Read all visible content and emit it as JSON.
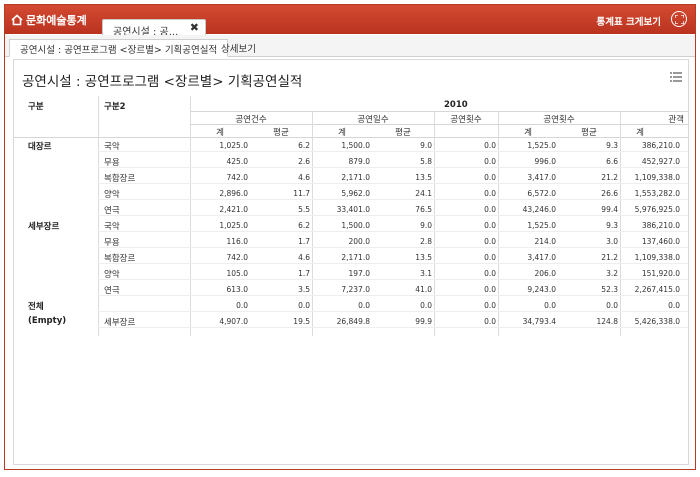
{
  "header": {
    "home_label": "문화예술통계",
    "main_tab_label": "공연시설 : 공...",
    "main_tab_close": "✖",
    "view_big_label": "통계표 크게보기"
  },
  "subtabs": [
    "공연시설 : 공연프로그램 <장르별> 기획공연실적",
    "상세보기"
  ],
  "report": {
    "title": "공연시설 : 공연프로그램 <장르별> 기획공연실적",
    "col1_header": "구분",
    "col2_header": "구분2",
    "year": "2010",
    "groups": [
      "공연건수",
      "공연일수",
      "공연횟수",
      "공연횟수",
      "관객"
    ],
    "subcols": [
      "계",
      "평균",
      "계",
      "평균",
      "",
      "계",
      "평균",
      "계"
    ],
    "rows": [
      {
        "g1": "대장르",
        "g2": "국악",
        "vals": [
          "1,025.0",
          "6.2",
          "1,500.0",
          "9.0",
          "0.0",
          "1,525.0",
          "9.3",
          "386,210.0"
        ]
      },
      {
        "g1": "",
        "g2": "무용",
        "vals": [
          "425.0",
          "2.6",
          "879.0",
          "5.8",
          "0.0",
          "996.0",
          "6.6",
          "452,927.0"
        ]
      },
      {
        "g1": "",
        "g2": "복합장르",
        "vals": [
          "742.0",
          "4.6",
          "2,171.0",
          "13.5",
          "0.0",
          "3,417.0",
          "21.2",
          "1,109,338.0"
        ]
      },
      {
        "g1": "",
        "g2": "양악",
        "vals": [
          "2,896.0",
          "11.7",
          "5,962.0",
          "24.1",
          "0.0",
          "6,572.0",
          "26.6",
          "1,553,282.0"
        ]
      },
      {
        "g1": "",
        "g2": "연극",
        "vals": [
          "2,421.0",
          "5.5",
          "33,401.0",
          "76.5",
          "0.0",
          "43,246.0",
          "99.4",
          "5,976,925.0"
        ]
      },
      {
        "g1": "세부장르",
        "g2": "국악",
        "vals": [
          "1,025.0",
          "6.2",
          "1,500.0",
          "9.0",
          "0.0",
          "1,525.0",
          "9.3",
          "386,210.0"
        ]
      },
      {
        "g1": "",
        "g2": "무용",
        "vals": [
          "116.0",
          "1.7",
          "200.0",
          "2.8",
          "0.0",
          "214.0",
          "3.0",
          "137,460.0"
        ]
      },
      {
        "g1": "",
        "g2": "복합장르",
        "vals": [
          "742.0",
          "4.6",
          "2,171.0",
          "13.5",
          "0.0",
          "3,417.0",
          "21.2",
          "1,109,338.0"
        ]
      },
      {
        "g1": "",
        "g2": "양악",
        "vals": [
          "105.0",
          "1.7",
          "197.0",
          "3.1",
          "0.0",
          "206.0",
          "3.2",
          "151,920.0"
        ]
      },
      {
        "g1": "",
        "g2": "연극",
        "vals": [
          "613.0",
          "3.5",
          "7,237.0",
          "41.0",
          "0.0",
          "9,243.0",
          "52.3",
          "2,267,415.0"
        ]
      },
      {
        "g1": "전체",
        "g2": "",
        "vals": [
          "0.0",
          "0.0",
          "0.0",
          "0.0",
          "0.0",
          "0.0",
          "0.0",
          "0.0"
        ]
      },
      {
        "g1": "(Empty)",
        "g2": "세부장르",
        "vals": [
          "4,907.0",
          "19.5",
          "26,849.8",
          "99.9",
          "0.0",
          "34,793.4",
          "124.8",
          "5,426,338.0"
        ]
      }
    ]
  },
  "colors": {
    "brand": "#c63c27",
    "grid": "#d6d6d6"
  },
  "icons": {
    "home": "home-icon",
    "expand": "expand-icon",
    "menu": "list-menu-icon"
  }
}
